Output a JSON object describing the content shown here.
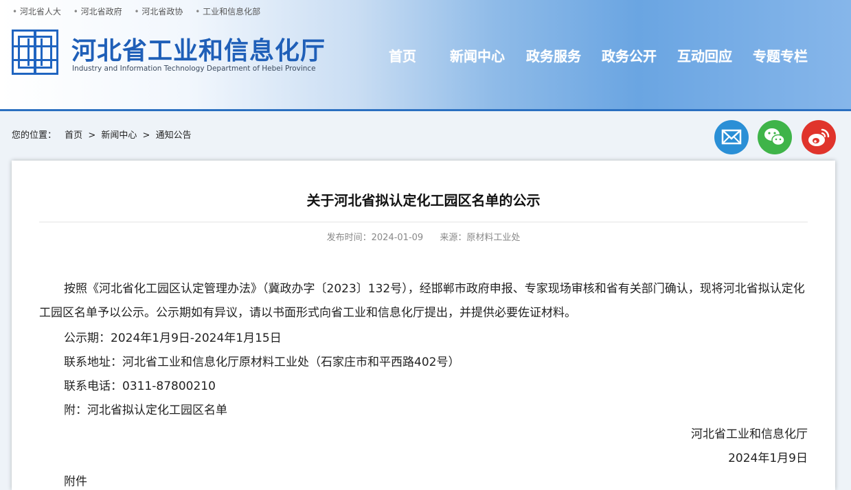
{
  "top_links": [
    "河北省人大",
    "河北省政府",
    "河北省政协",
    "工业和信息化部"
  ],
  "site": {
    "title": "河北省工业和信息化厅",
    "subtitle": "Industry and Information Technology Department of Hebei Province"
  },
  "nav": [
    "首页",
    "新闻中心",
    "政务服务",
    "政务公开",
    "互动回应",
    "专题专栏"
  ],
  "breadcrumb": {
    "label": "您的位置：",
    "items": [
      "首页",
      ">",
      "新闻中心",
      ">",
      "通知公告"
    ]
  },
  "share_icons": [
    "email-icon",
    "wechat-icon",
    "weibo-icon"
  ],
  "colors": {
    "accent": "#1f5fb8",
    "email": "#2a8fd6",
    "wechat": "#3fb449",
    "weibo": "#e0342c"
  },
  "article": {
    "title": "关于河北省拟认定化工园区名单的公示",
    "publish_label": "发布时间：2024-01-09",
    "source_label": "来源：原材料工业处",
    "para1": "按照《河北省化工园区认定管理办法》（冀政办字〔2023〕132号），经邯郸市政府申报、专家现场审核和省有关部门确认，现将河北省拟认定化工园区名单予以公示。公示期如有异议，请以书面形式向省工业和信息化厅提出，并提供必要佐证材料。",
    "period": "公示期：2024年1月9日-2024年1月15日",
    "address": "联系地址：河北省工业和信息化厅原材料工业处（石家庄市和平西路402号）",
    "phone": "联系电话：0311-87800210",
    "attachment": "附：河北省拟认定化工园区名单",
    "signature": "河北省工业和信息化厅",
    "date": "2024年1月9日",
    "attach_label": "附件"
  }
}
